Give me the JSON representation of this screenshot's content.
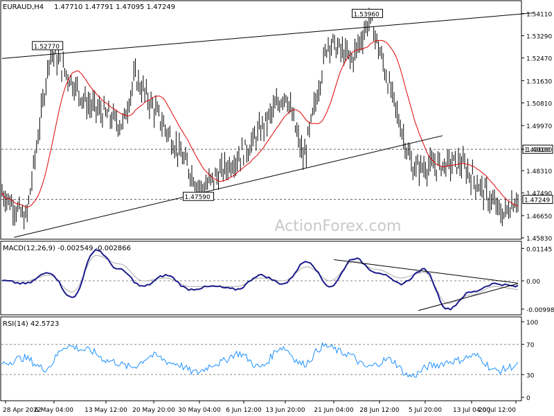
{
  "header": {
    "symbol_timeframe": "EURAUD,H4",
    "ohlc": "1.47710 1.47791 1.47095 1.47249"
  },
  "watermark": "ActionForex.com",
  "colors": {
    "bars": "#000000",
    "ma": "#e00000",
    "macd_line": "#1a1a8c",
    "signal_line": "#aaaaaa",
    "rsi_line": "#1e90ff",
    "grid_dashed": "#888888",
    "watermark": "#c8c8c8"
  },
  "chart_data": [
    {
      "type": "candlestick",
      "panel": "price",
      "y_ticks": [
        "1.54110",
        "1.53290",
        "1.52470",
        "1.51630",
        "1.50810",
        "1.49970",
        "1.49100",
        "1.48310",
        "1.47490",
        "1.46650",
        "1.45830"
      ],
      "ylim": [
        1.4583,
        1.5425
      ],
      "price_labels": [
        {
          "text": "1.52770",
          "value": 1.5277
        },
        {
          "text": "1.53960",
          "value": 1.5396
        },
        {
          "text": "1.47590",
          "value": 1.4759
        }
      ],
      "right_badges": [
        {
          "text": "1.49100",
          "value": 1.491
        },
        {
          "text": "1.47249",
          "value": 1.47249
        }
      ],
      "horizontal_levels": [
        1.491,
        1.47249
      ],
      "trendlines": [
        {
          "from": [
            "28 Apr 2022",
            1.5245
          ],
          "to": [
            "25 Jul 2022",
            1.5413
          ]
        },
        {
          "from": [
            "30 Apr 2022",
            1.4585
          ],
          "to": [
            "10 Jul 2022",
            1.496
          ]
        }
      ],
      "series_desc": "EURAUD H4 price bars with red moving average",
      "key_points": [
        {
          "x": "28 Apr 2022",
          "y": 1.475
        },
        {
          "x": "2 May 2022",
          "y": 1.465
        },
        {
          "x": "6 May 2022",
          "y": 1.5277
        },
        {
          "x": "12 May 2022",
          "y": 1.508
        },
        {
          "x": "18 May 2022",
          "y": 1.5
        },
        {
          "x": "20 May 2022",
          "y": 1.518
        },
        {
          "x": "31 May 2022",
          "y": 1.4759
        },
        {
          "x": "8 Jun 2022",
          "y": 1.492
        },
        {
          "x": "14 Jun 2022",
          "y": 1.512
        },
        {
          "x": "17 Jun 2022",
          "y": 1.487
        },
        {
          "x": "21 Jun 2022",
          "y": 1.531
        },
        {
          "x": "25 Jun 2022",
          "y": 1.524
        },
        {
          "x": "28 Jun 2022",
          "y": 1.5396
        },
        {
          "x": "5 Jul 2022",
          "y": 1.484
        },
        {
          "x": "13 Jul 2022",
          "y": 1.486
        },
        {
          "x": "20 Jul 2022",
          "y": 1.4665
        },
        {
          "x": "22 Jul 2022",
          "y": 1.4725
        }
      ]
    },
    {
      "type": "line",
      "panel": "macd",
      "title": "MACD(12,26,9) -0.002549 -0.002866",
      "y_ticks": [
        "0.01145",
        "0.00",
        "-0.009985"
      ],
      "ylim": [
        -0.0115,
        0.013
      ],
      "series": [
        {
          "name": "MACD",
          "values": [
            0.0,
            -0.001,
            0.003,
            -0.006,
            0.011,
            0.004,
            -0.002,
            0.002,
            -0.003,
            -0.002,
            -0.003,
            0.002,
            -0.001,
            0.007,
            -0.002,
            0.008,
            0.003,
            -0.001,
            0.004,
            -0.01,
            -0.004,
            -0.001,
            -0.002
          ]
        },
        {
          "name": "Signal",
          "values": [
            0.0,
            0.0,
            0.002,
            -0.004,
            0.009,
            0.006,
            0.0,
            0.001,
            -0.002,
            -0.002,
            -0.002,
            0.001,
            0.0,
            0.005,
            0.0,
            0.007,
            0.004,
            0.001,
            0.003,
            -0.008,
            -0.005,
            -0.002,
            -0.003
          ]
        }
      ],
      "trendlines": [
        {
          "from": [
            "22 Jun 2022",
            0.0075
          ],
          "to": [
            "22 Jul 2022",
            -0.0008
          ]
        },
        {
          "from": [
            "6 Jul 2022",
            -0.0105
          ],
          "to": [
            "22 Jul 2022",
            -0.001
          ]
        }
      ]
    },
    {
      "type": "line",
      "panel": "rsi",
      "title": "RSI(14) 42.5723",
      "y_ticks": [
        "100",
        "70",
        "30",
        "0"
      ],
      "ylim": [
        0,
        100
      ],
      "levels": [
        70,
        30
      ],
      "series": [
        {
          "name": "RSI",
          "values": [
            45,
            52,
            38,
            68,
            62,
            48,
            40,
            55,
            45,
            33,
            45,
            58,
            40,
            66,
            44,
            68,
            58,
            40,
            50,
            28,
            42,
            48,
            55,
            35,
            42
          ]
        }
      ]
    }
  ],
  "x_axis": {
    "labels": [
      "28 Apr 2022",
      "6 May 04:00",
      "13 May 12:00",
      "20 May 20:00",
      "30 May 04:00",
      "6 Jun 12:00",
      "13 Jun 20:00",
      "21 Jun 04:00",
      "28 Jun 12:00",
      "5 Jul 20:00",
      "13 Jul 04:00",
      "20 Jul 12:00"
    ]
  }
}
